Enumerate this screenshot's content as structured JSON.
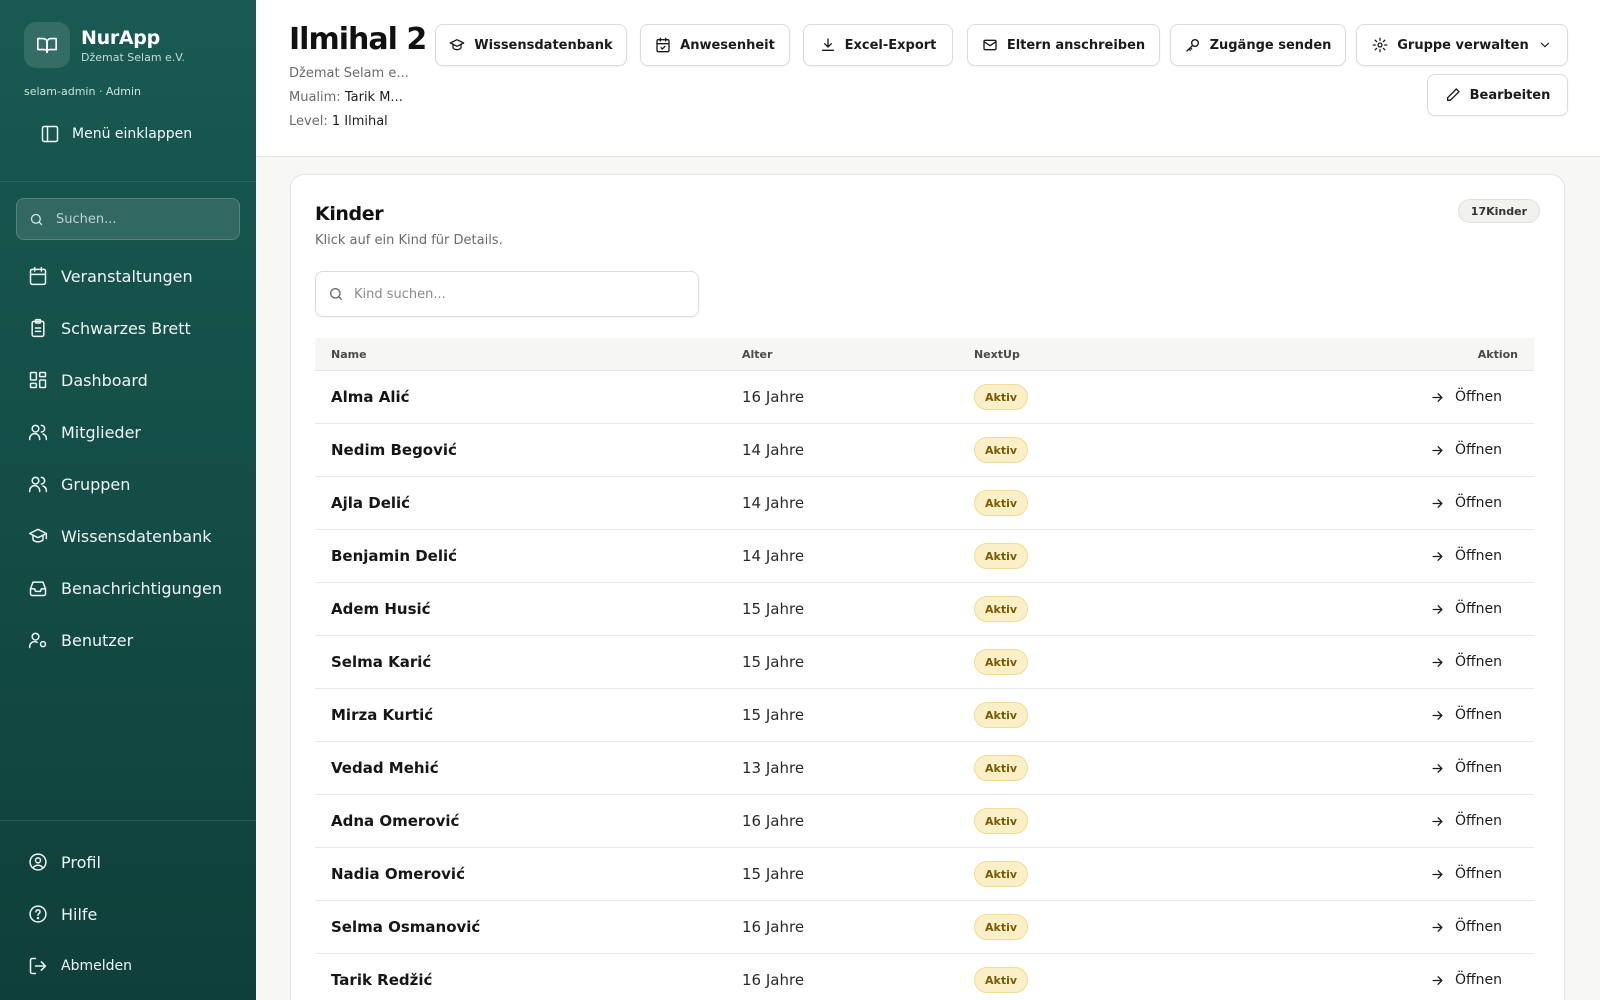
{
  "app": {
    "name": "NurApp",
    "org": "Džemat Selam e.V.",
    "user_line": "selam-admin · Admin",
    "collapse_label": "Menü einklappen",
    "search_placeholder": "Suchen..."
  },
  "sidebar": {
    "items": [
      {
        "label": "Veranstaltungen",
        "icon": "calendar-icon"
      },
      {
        "label": "Schwarzes Brett",
        "icon": "clipboard-icon"
      },
      {
        "label": "Dashboard",
        "icon": "dashboard-icon"
      },
      {
        "label": "Mitglieder",
        "icon": "users-icon"
      },
      {
        "label": "Gruppen",
        "icon": "users-icon"
      },
      {
        "label": "Wissensdatenbank",
        "icon": "graduation-cap-icon"
      },
      {
        "label": "Benachrichtigungen",
        "icon": "inbox-icon"
      },
      {
        "label": "Benutzer",
        "icon": "user-cog-icon"
      }
    ],
    "bottom": [
      {
        "label": "Profil",
        "icon": "user-circle-icon"
      },
      {
        "label": "Hilfe",
        "icon": "help-circle-icon"
      },
      {
        "label": "Abmelden",
        "icon": "logout-icon"
      }
    ]
  },
  "header": {
    "title": "Ilmihal 2",
    "org_line": "Džemat Selam e...",
    "mualim_label": "Mualim:",
    "mualim_value": "Tarik M...",
    "level_label": "Level:",
    "level_value": "1 Ilmihal",
    "buttons": {
      "knowledge": "Wissensdatenbank",
      "attendance": "Anwesenheit",
      "export": "Excel-Export",
      "email": "Eltern anschreiben",
      "access": "Zugänge senden",
      "manage": "Gruppe verwalten",
      "edit": "Bearbeiten"
    }
  },
  "kids": {
    "title": "Kinder",
    "subtitle": "Klick auf ein Kind für Details.",
    "count_badge": "17Kinder",
    "search_placeholder": "Kind suchen...",
    "columns": {
      "name": "Name",
      "age": "Alter",
      "nextup": "NextUp",
      "action": "Aktion"
    },
    "action_label": "Öffnen",
    "rows": [
      {
        "name": "Alma Alić",
        "age": "16 Jahre",
        "status": "Aktiv"
      },
      {
        "name": "Nedim Begović",
        "age": "14 Jahre",
        "status": "Aktiv"
      },
      {
        "name": "Ajla Delić",
        "age": "14 Jahre",
        "status": "Aktiv"
      },
      {
        "name": "Benjamin Delić",
        "age": "14 Jahre",
        "status": "Aktiv"
      },
      {
        "name": "Adem Husić",
        "age": "15 Jahre",
        "status": "Aktiv"
      },
      {
        "name": "Selma Karić",
        "age": "15 Jahre",
        "status": "Aktiv"
      },
      {
        "name": "Mirza Kurtić",
        "age": "15 Jahre",
        "status": "Aktiv"
      },
      {
        "name": "Vedad Mehić",
        "age": "13 Jahre",
        "status": "Aktiv"
      },
      {
        "name": "Adna Omerović",
        "age": "16 Jahre",
        "status": "Aktiv"
      },
      {
        "name": "Nadia Omerović",
        "age": "15 Jahre",
        "status": "Aktiv"
      },
      {
        "name": "Selma Osmanović",
        "age": "16 Jahre",
        "status": "Aktiv"
      },
      {
        "name": "Tarik Redžić",
        "age": "16 Jahre",
        "status": "Aktiv"
      }
    ]
  },
  "colors": {
    "sidebar": "#185a52",
    "badge_bg": "#fbefc7",
    "badge_text": "#7a5a06"
  }
}
